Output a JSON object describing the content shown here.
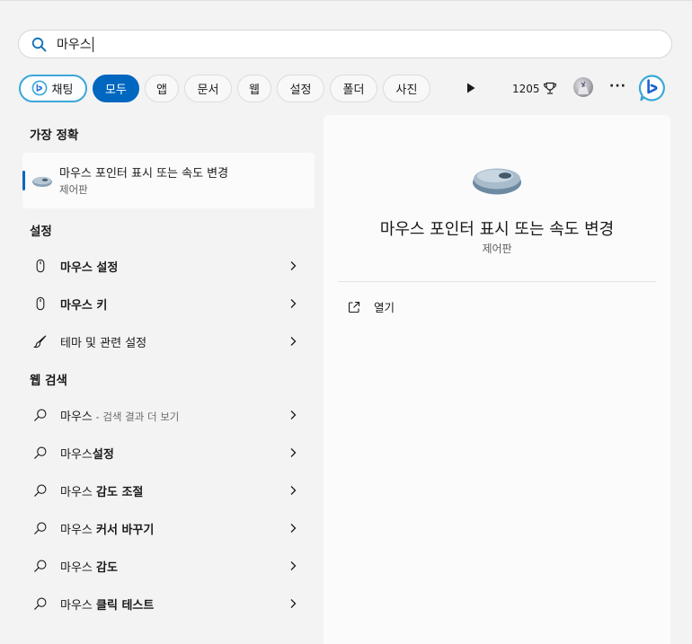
{
  "search": {
    "query": "마우스"
  },
  "filters": {
    "chat": "채팅",
    "items": [
      "모두",
      "앱",
      "문서",
      "웹",
      "설정",
      "폴더",
      "사진"
    ],
    "points": "1205"
  },
  "sections": {
    "best_match": "가장 정확",
    "settings": "설정",
    "web_search": "웹 검색"
  },
  "best": {
    "title": "마우스 포인터 표시 또는 속도 변경",
    "subtitle": "제어판"
  },
  "settings_items": [
    {
      "bold": "마우스 설정",
      "rest": ""
    },
    {
      "bold": "마우스 키",
      "rest": ""
    },
    {
      "bold": "",
      "rest": "테마 및 관련 설정"
    }
  ],
  "web_items": [
    {
      "plain": "마우스",
      "bold": "",
      "hint": " - 검색 결과 더 보기"
    },
    {
      "plain": "마우스",
      "bold": "설정",
      "hint": ""
    },
    {
      "plain": "마우스 ",
      "bold": "감도 조절",
      "hint": ""
    },
    {
      "plain": "마우스 ",
      "bold": "커서 바꾸기",
      "hint": ""
    },
    {
      "plain": "마우스 ",
      "bold": "감도",
      "hint": ""
    },
    {
      "plain": "마우스 ",
      "bold": "클릭 테스트",
      "hint": ""
    }
  ],
  "preview": {
    "title": "마우스 포인터 표시 또는 속도 변경",
    "subtitle": "제어판",
    "open_label": "열기"
  },
  "colors": {
    "accent": "#0067c0",
    "bing": "#3ba7d9"
  }
}
